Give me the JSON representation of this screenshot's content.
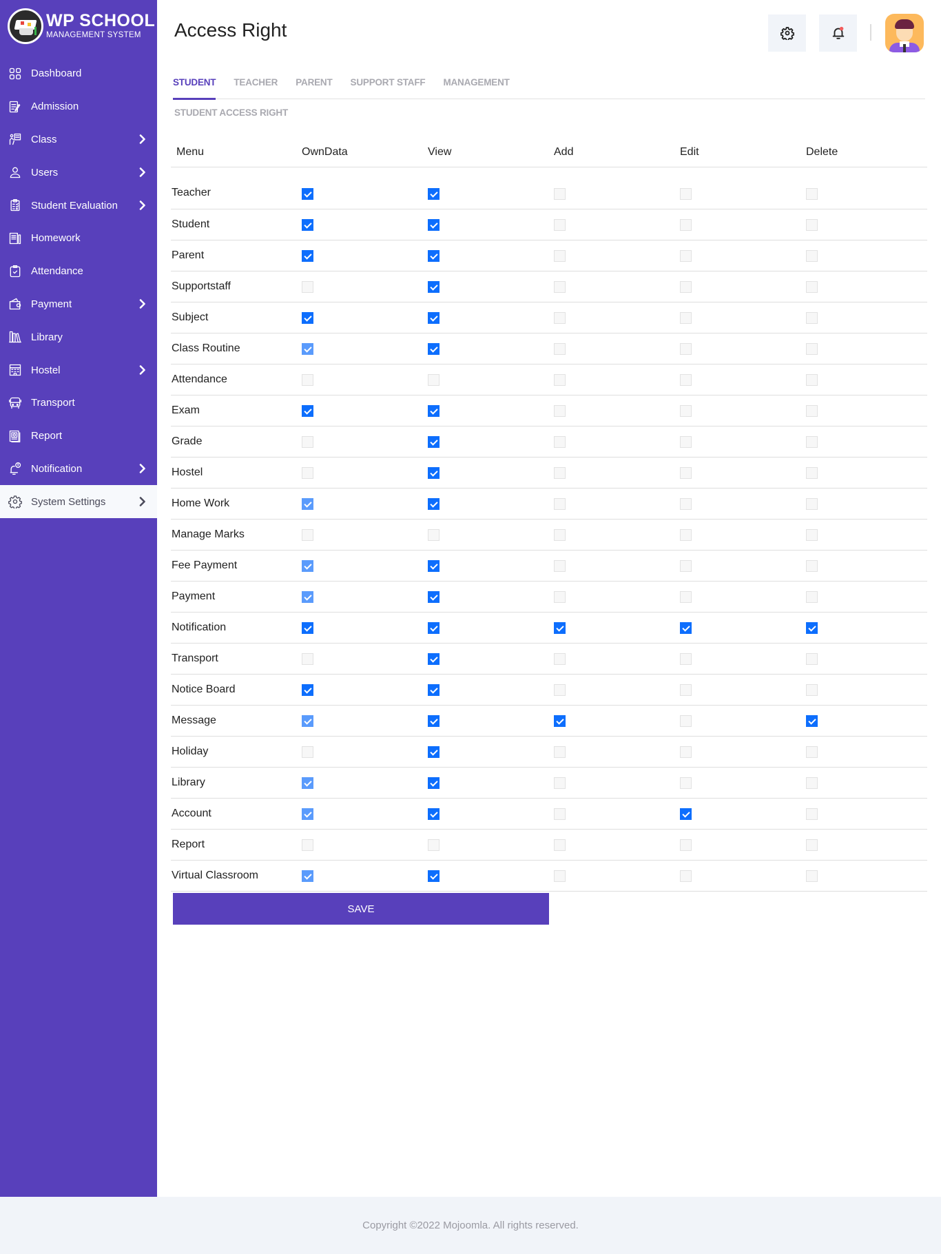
{
  "brand": {
    "title": "WP SCHOOL",
    "subtitle": "MANAGEMENT SYSTEM"
  },
  "sidebar": {
    "items": [
      {
        "label": "Dashboard",
        "icon": "dashboard-grid-icon",
        "has_submenu": false,
        "active": false
      },
      {
        "label": "Admission",
        "icon": "admission-form-icon",
        "has_submenu": false,
        "active": false
      },
      {
        "label": "Class",
        "icon": "class-teacher-board-icon",
        "has_submenu": true,
        "active": false
      },
      {
        "label": "Users",
        "icon": "user-icon",
        "has_submenu": true,
        "active": false
      },
      {
        "label": "Student Evaluation",
        "icon": "clipboard-checklist-icon",
        "has_submenu": true,
        "active": false
      },
      {
        "label": "Homework",
        "icon": "homework-notebook-icon",
        "has_submenu": false,
        "active": false
      },
      {
        "label": "Attendance",
        "icon": "attendance-check-icon",
        "has_submenu": false,
        "active": false
      },
      {
        "label": "Payment",
        "icon": "wallet-icon",
        "has_submenu": true,
        "active": false
      },
      {
        "label": "Library",
        "icon": "books-icon",
        "has_submenu": false,
        "active": false
      },
      {
        "label": "Hostel",
        "icon": "hostel-building-icon",
        "has_submenu": true,
        "active": false
      },
      {
        "label": "Transport",
        "icon": "bus-icon",
        "has_submenu": false,
        "active": false
      },
      {
        "label": "Report",
        "icon": "report-icon",
        "has_submenu": false,
        "active": false
      },
      {
        "label": "Notification",
        "icon": "notification-bell-icon",
        "has_submenu": true,
        "active": false
      },
      {
        "label": "System Settings",
        "icon": "gear-icon",
        "has_submenu": true,
        "active": true
      }
    ]
  },
  "header": {
    "title": "Access Right",
    "settings_icon": "gear-icon",
    "notification_icon": "bell-icon",
    "notification_dot_color": "#f25c5c",
    "avatar": "user-avatar"
  },
  "tabs": [
    {
      "label": "STUDENT",
      "active": true
    },
    {
      "label": "TEACHER",
      "active": false
    },
    {
      "label": "PARENT",
      "active": false
    },
    {
      "label": "SUPPORT STAFF",
      "active": false
    },
    {
      "label": "MANAGEMENT",
      "active": false
    }
  ],
  "section_title": "STUDENT ACCESS RIGHT",
  "table": {
    "columns": [
      "Menu",
      "OwnData",
      "View",
      "Add",
      "Edit",
      "Delete"
    ],
    "rows": [
      {
        "menu": "Teacher",
        "own_data": "checked",
        "view": "checked",
        "add": "unchecked",
        "edit": "unchecked",
        "delete": "unchecked"
      },
      {
        "menu": "Student",
        "own_data": "checked",
        "view": "checked",
        "add": "unchecked",
        "edit": "unchecked",
        "delete": "unchecked"
      },
      {
        "menu": "Parent",
        "own_data": "checked",
        "view": "checked",
        "add": "unchecked",
        "edit": "unchecked",
        "delete": "unchecked"
      },
      {
        "menu": "Supportstaff",
        "own_data": "unchecked",
        "view": "checked",
        "add": "unchecked",
        "edit": "unchecked",
        "delete": "unchecked"
      },
      {
        "menu": "Subject",
        "own_data": "checked",
        "view": "checked",
        "add": "unchecked",
        "edit": "unchecked",
        "delete": "unchecked"
      },
      {
        "menu": "Class Routine",
        "own_data": "checked-disabled",
        "view": "checked",
        "add": "unchecked",
        "edit": "unchecked",
        "delete": "unchecked"
      },
      {
        "menu": "Attendance",
        "own_data": "unchecked",
        "view": "unchecked",
        "add": "unchecked",
        "edit": "unchecked",
        "delete": "unchecked"
      },
      {
        "menu": "Exam",
        "own_data": "checked",
        "view": "checked",
        "add": "unchecked",
        "edit": "unchecked",
        "delete": "unchecked"
      },
      {
        "menu": "Grade",
        "own_data": "unchecked",
        "view": "checked",
        "add": "unchecked",
        "edit": "unchecked",
        "delete": "unchecked"
      },
      {
        "menu": "Hostel",
        "own_data": "unchecked",
        "view": "checked",
        "add": "unchecked",
        "edit": "unchecked",
        "delete": "unchecked"
      },
      {
        "menu": "Home Work",
        "own_data": "checked-disabled",
        "view": "checked",
        "add": "unchecked",
        "edit": "unchecked",
        "delete": "unchecked"
      },
      {
        "menu": "Manage Marks",
        "own_data": "unchecked",
        "view": "unchecked",
        "add": "unchecked",
        "edit": "unchecked",
        "delete": "unchecked"
      },
      {
        "menu": "Fee Payment",
        "own_data": "checked-disabled",
        "view": "checked",
        "add": "unchecked",
        "edit": "unchecked",
        "delete": "unchecked"
      },
      {
        "menu": "Payment",
        "own_data": "checked-disabled",
        "view": "checked",
        "add": "unchecked",
        "edit": "unchecked",
        "delete": "unchecked"
      },
      {
        "menu": "Notification",
        "own_data": "checked",
        "view": "checked",
        "add": "checked",
        "edit": "checked",
        "delete": "checked"
      },
      {
        "menu": "Transport",
        "own_data": "unchecked",
        "view": "checked",
        "add": "unchecked",
        "edit": "unchecked",
        "delete": "unchecked"
      },
      {
        "menu": "Notice Board",
        "own_data": "checked",
        "view": "checked",
        "add": "unchecked",
        "edit": "unchecked",
        "delete": "unchecked"
      },
      {
        "menu": "Message",
        "own_data": "checked-disabled",
        "view": "checked",
        "add": "checked",
        "edit": "unchecked",
        "delete": "checked"
      },
      {
        "menu": "Holiday",
        "own_data": "unchecked",
        "view": "checked",
        "add": "unchecked",
        "edit": "unchecked",
        "delete": "unchecked"
      },
      {
        "menu": "Library",
        "own_data": "checked-disabled",
        "view": "checked",
        "add": "unchecked",
        "edit": "unchecked",
        "delete": "unchecked"
      },
      {
        "menu": "Account",
        "own_data": "checked-disabled",
        "view": "checked",
        "add": "unchecked",
        "edit": "checked",
        "delete": "unchecked"
      },
      {
        "menu": "Report",
        "own_data": "unchecked",
        "view": "unchecked",
        "add": "unchecked",
        "edit": "unchecked",
        "delete": "unchecked"
      },
      {
        "menu": "Virtual Classroom",
        "own_data": "checked-disabled",
        "view": "checked",
        "add": "unchecked",
        "edit": "unchecked",
        "delete": "unchecked"
      }
    ]
  },
  "save_label": "SAVE",
  "footer": {
    "text": "Copyright ©2022 Mojoomla. All rights reserved."
  },
  "colors": {
    "brand_purple": "#5840bb",
    "checkbox_blue": "#0d6efd",
    "checkbox_blue_dim": "#5a9bfc",
    "footer_bg": "#f1f4f9"
  }
}
